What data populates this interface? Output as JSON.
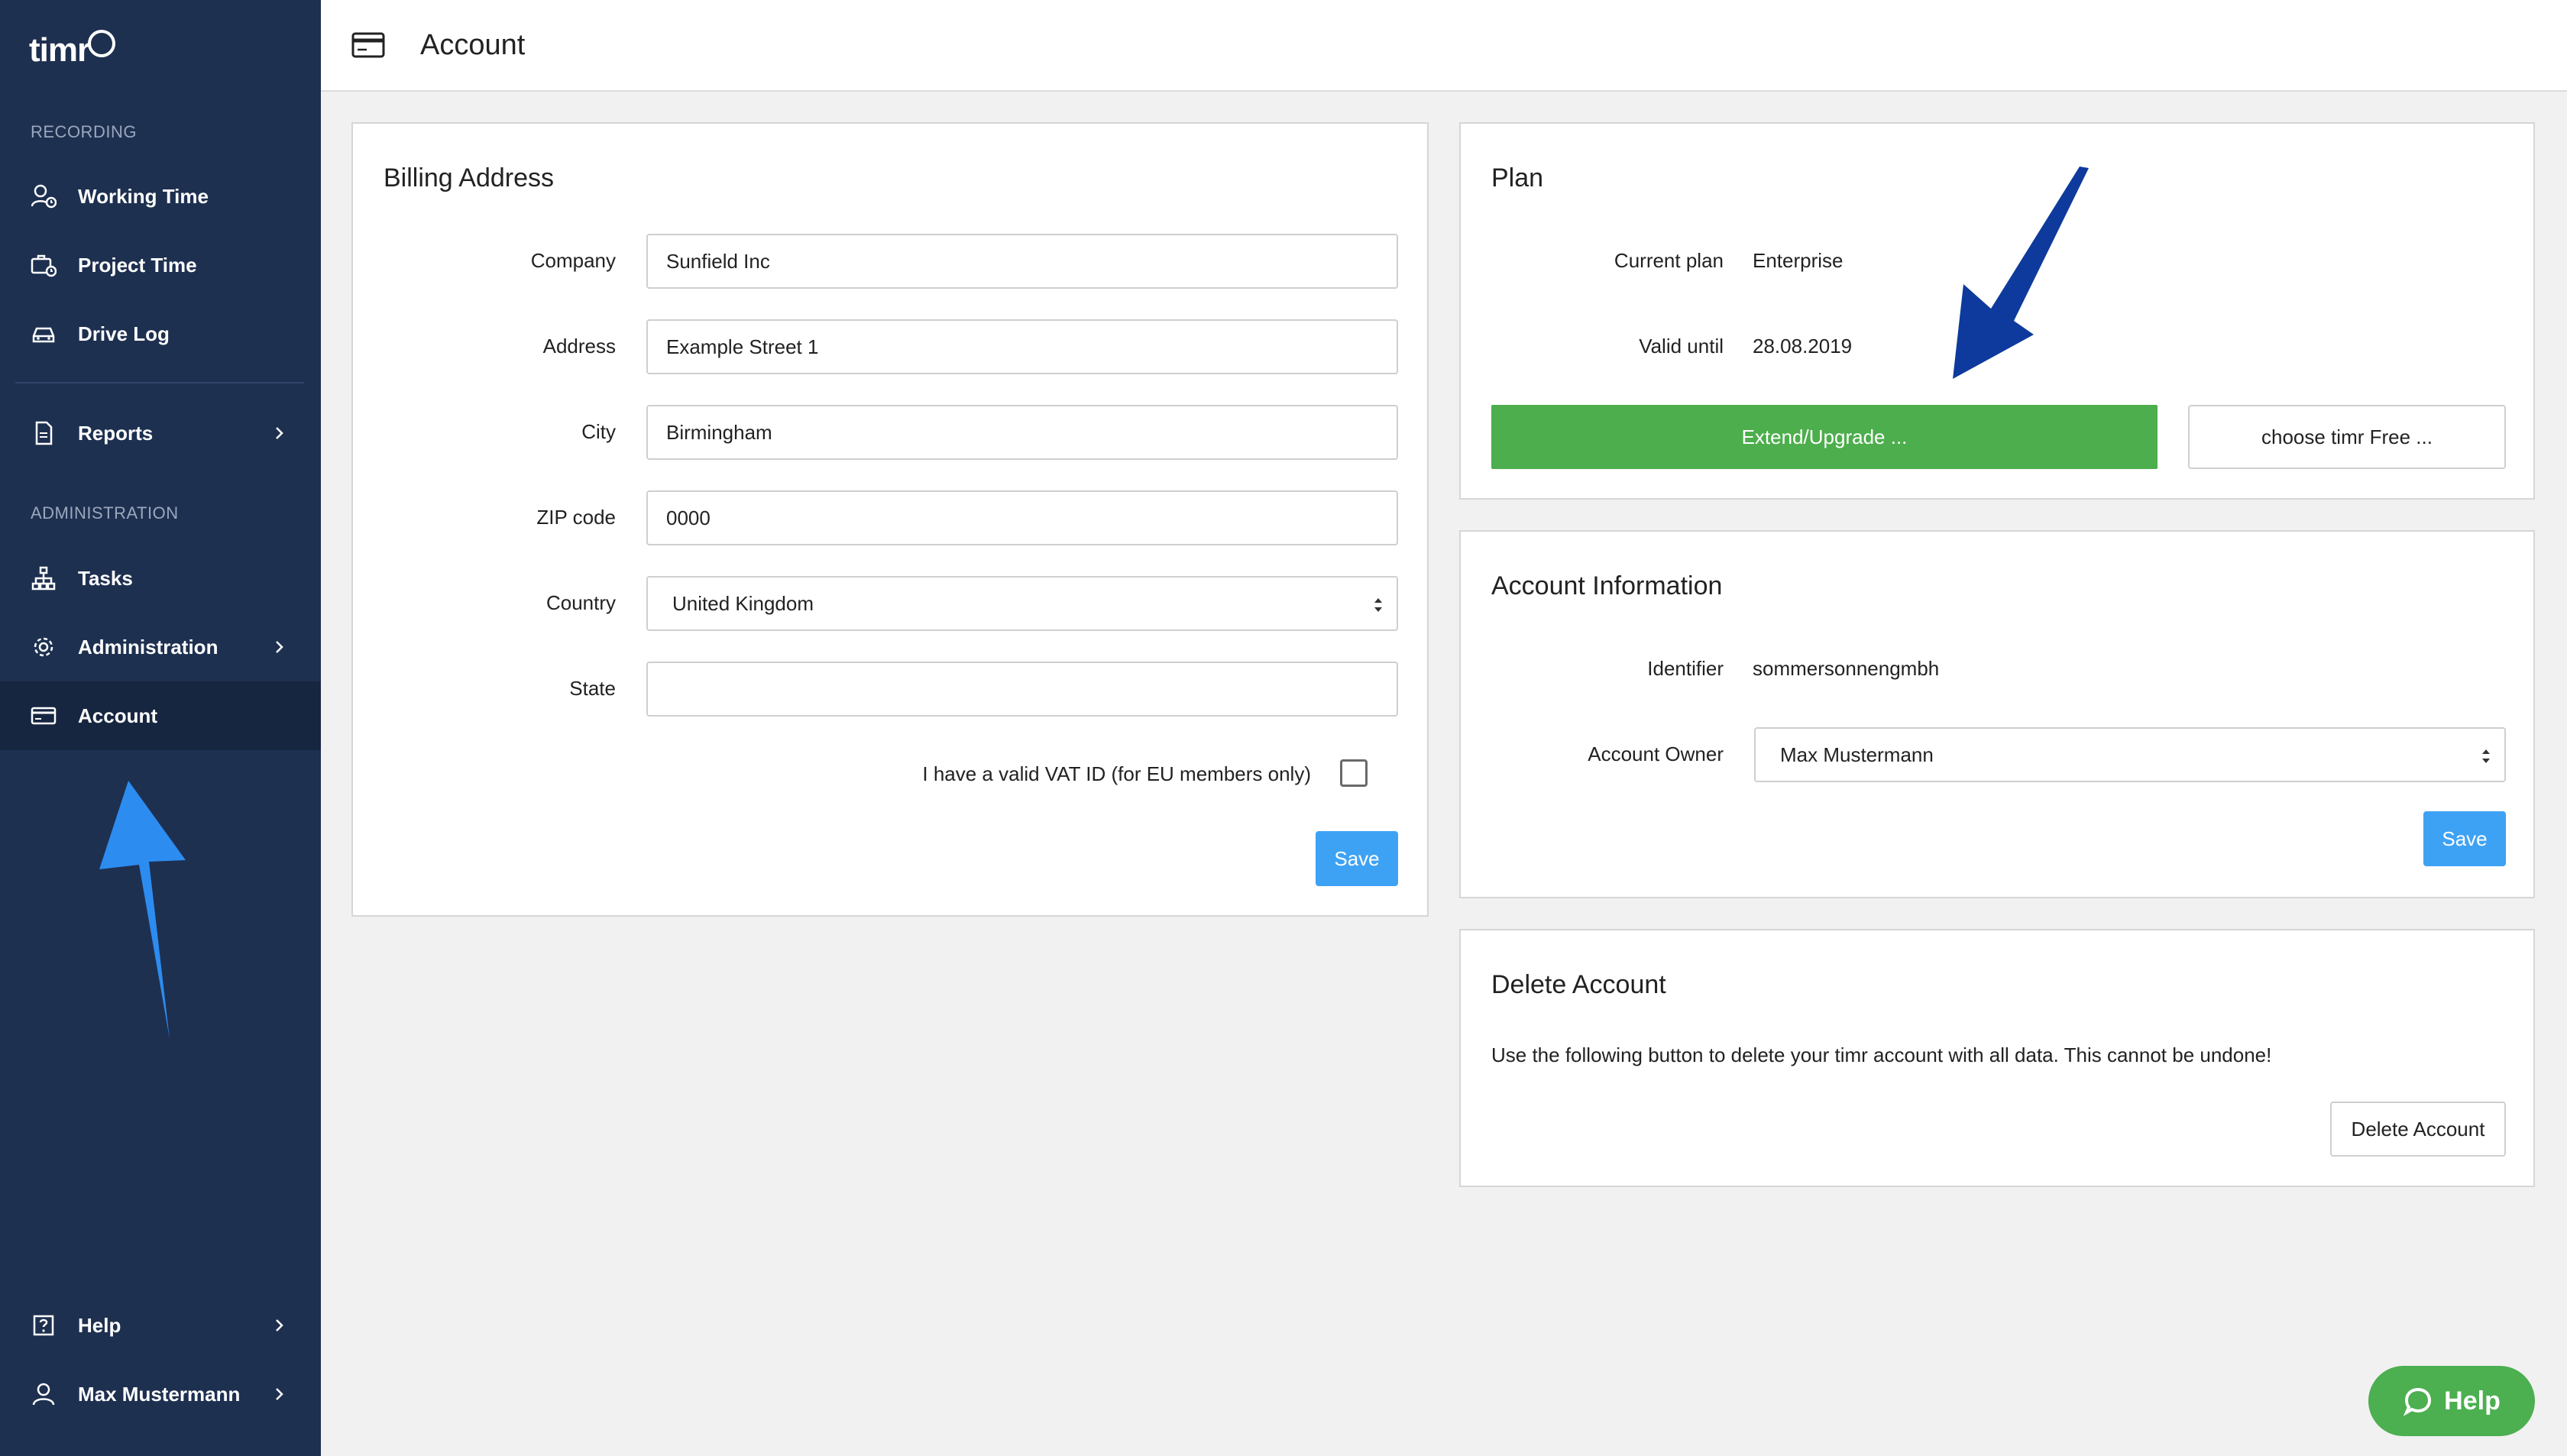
{
  "app": {
    "logo_text": "timr"
  },
  "header": {
    "title": "Account"
  },
  "sidebar": {
    "section_recording": "RECORDING",
    "section_administration": "ADMINISTRATION",
    "items": [
      {
        "label": "Working Time",
        "icon": "user-clock-icon"
      },
      {
        "label": "Project Time",
        "icon": "briefcase-clock-icon"
      },
      {
        "label": "Drive Log",
        "icon": "car-icon"
      },
      {
        "label": "Reports",
        "icon": "document-icon"
      },
      {
        "label": "Tasks",
        "icon": "hierarchy-icon"
      },
      {
        "label": "Administration",
        "icon": "gear-icon"
      },
      {
        "label": "Account",
        "icon": "credit-card-icon"
      },
      {
        "label": "Help",
        "icon": "question-icon"
      },
      {
        "label": "Max Mustermann",
        "icon": "user-icon"
      }
    ]
  },
  "billing": {
    "title": "Billing Address",
    "company_label": "Company",
    "company_value": "Sunfield Inc",
    "address_label": "Address",
    "address_value": "Example Street 1",
    "city_label": "City",
    "city_value": "Birmingham",
    "zip_label": "ZIP code",
    "zip_value": "0000",
    "country_label": "Country",
    "country_value": "United Kingdom",
    "state_label": "State",
    "state_value": "",
    "vat_label": "I have a valid VAT ID (for EU members only)",
    "save_label": "Save"
  },
  "plan": {
    "title": "Plan",
    "current_plan_label": "Current plan",
    "current_plan_value": "Enterprise",
    "valid_until_label": "Valid until",
    "valid_until_value": "28.08.2019",
    "extend_label": "Extend/Upgrade ...",
    "free_label": "choose timr Free ..."
  },
  "account_info": {
    "title": "Account Information",
    "identifier_label": "Identifier",
    "identifier_value": "sommersonnengmbh",
    "owner_label": "Account Owner",
    "owner_value": "Max Mustermann",
    "save_label": "Save"
  },
  "delete_account": {
    "title": "Delete Account",
    "description": "Use the following button to delete your timr account with all data. This cannot be undone!",
    "button_label": "Delete Account"
  },
  "help_fab": {
    "label": "Help"
  },
  "colors": {
    "sidebar_bg": "#1e3050",
    "sidebar_active": "#172640",
    "primary_blue": "#3ea2f4",
    "green": "#4cae4c",
    "arrow_dark": "#0d3a9c",
    "arrow_light": "#2c8cf0"
  }
}
